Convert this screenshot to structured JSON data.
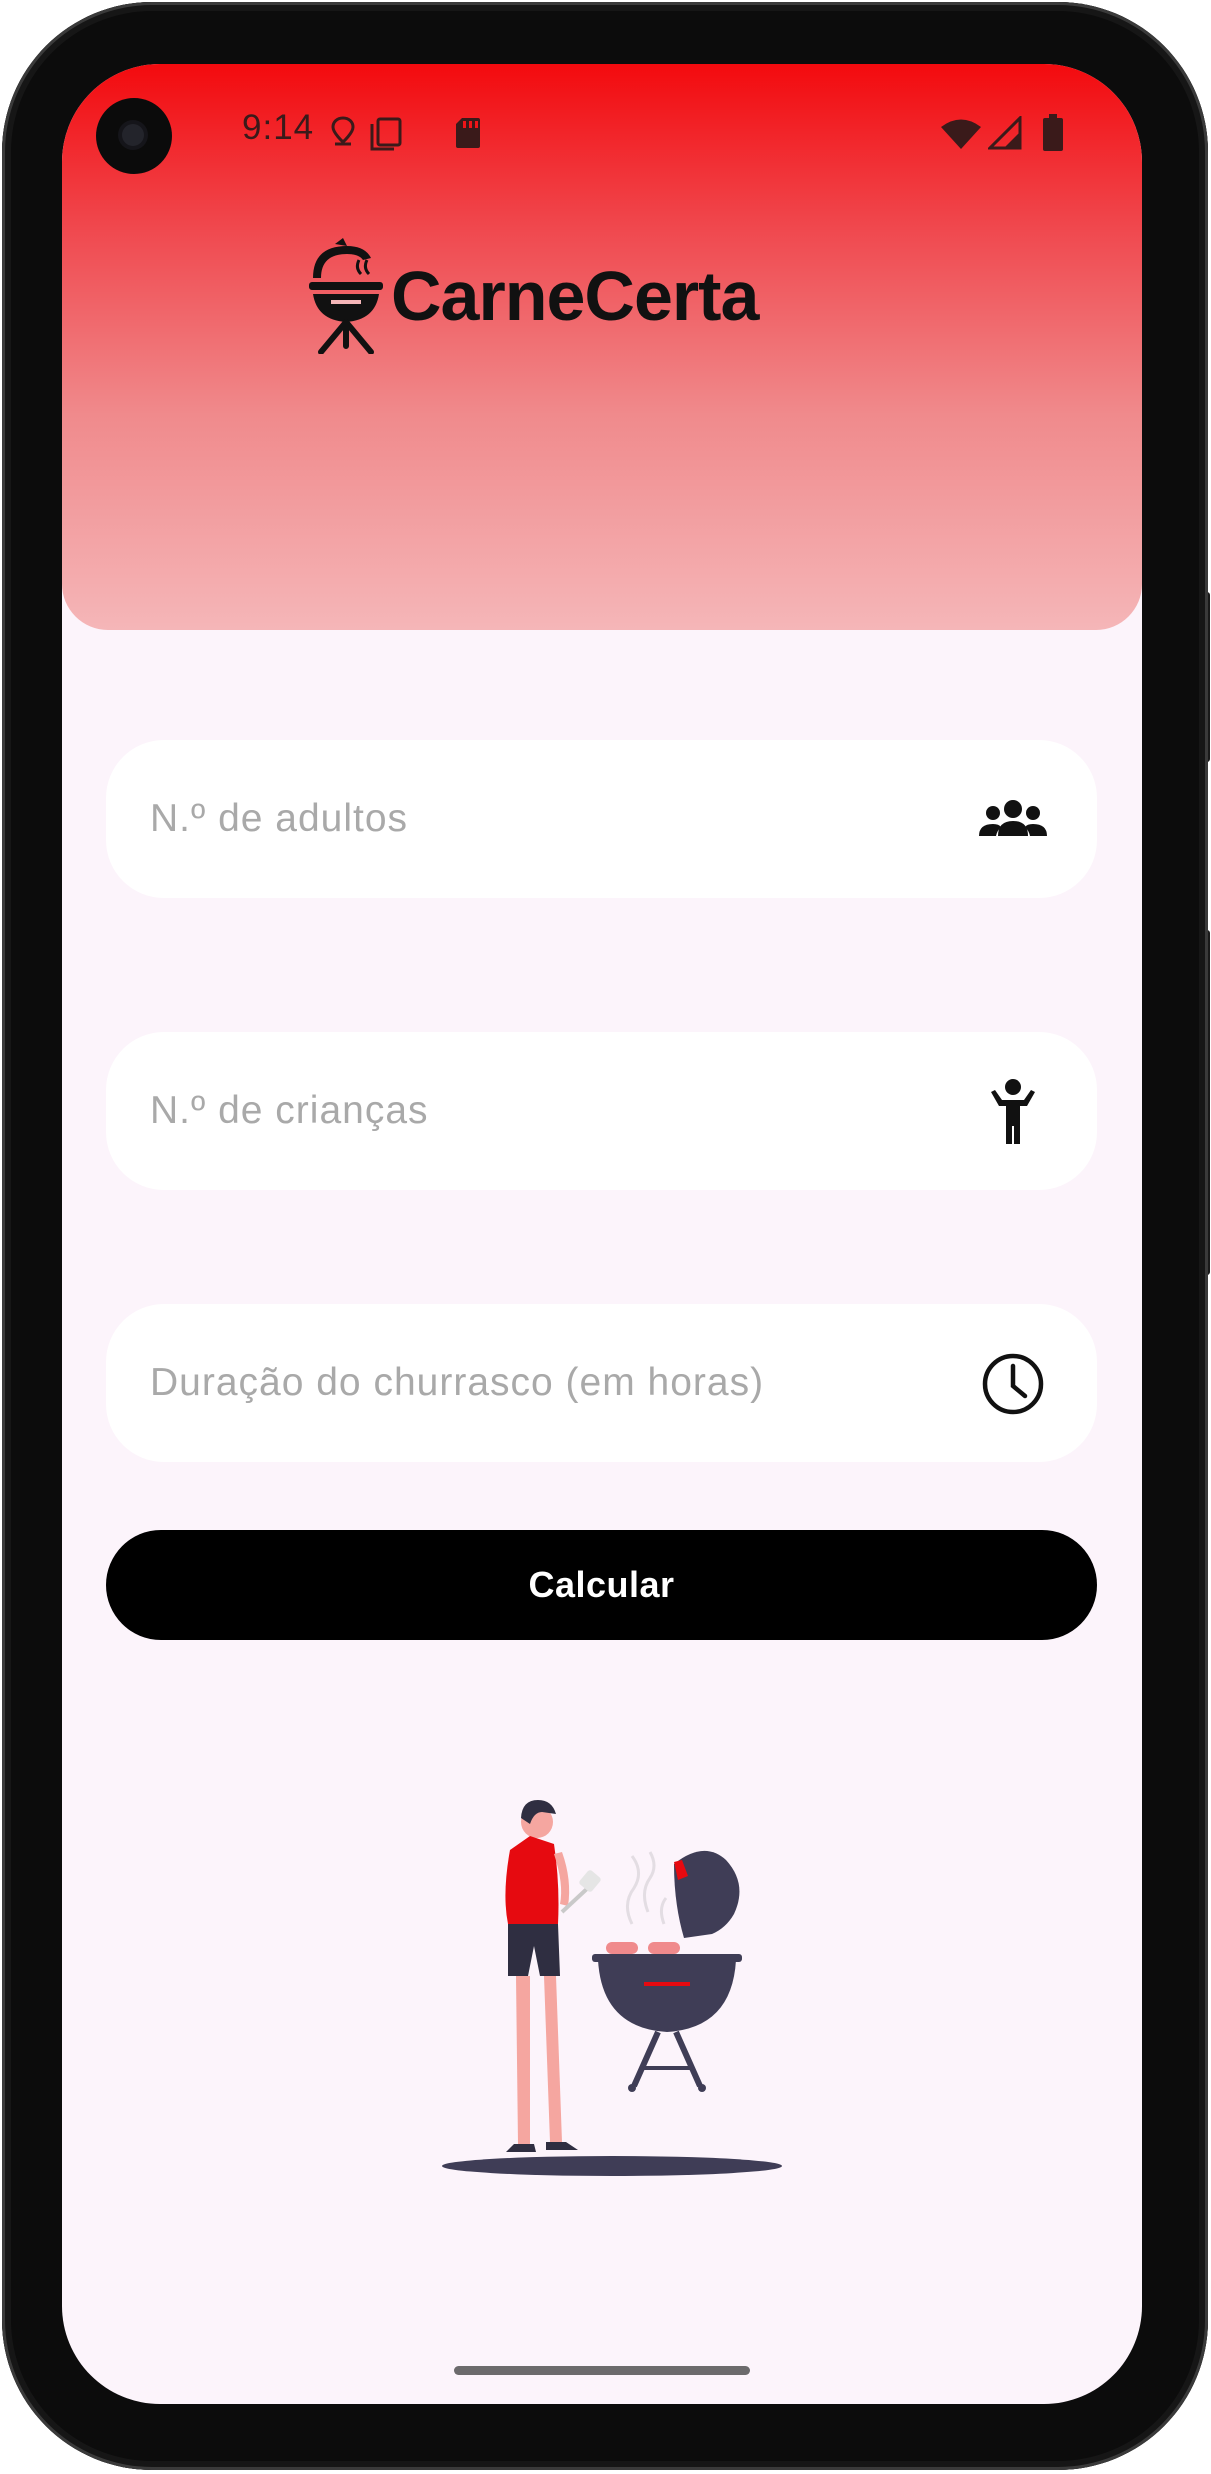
{
  "status_bar": {
    "time": "9:14",
    "left_icons": [
      "location-icon",
      "copy-icon",
      "sd-card-icon"
    ],
    "right_icons": [
      "wifi-icon",
      "signal-icon",
      "battery-icon"
    ]
  },
  "header": {
    "app_name": "CarneCerta",
    "logo_icon": "grill-icon",
    "colors": {
      "top": "#f30a0e",
      "bottom": "#f5b6b8"
    }
  },
  "form": {
    "adults": {
      "placeholder": "N.º de adultos",
      "value": "",
      "icon": "group-icon"
    },
    "children": {
      "placeholder": "N.º de crianças",
      "value": "",
      "icon": "child-icon"
    },
    "duration": {
      "placeholder": "Duração do churrasco (em horas)",
      "value": "",
      "icon": "clock-icon"
    },
    "submit_label": "Calcular"
  },
  "illustration": {
    "name": "person-grilling-illustration",
    "accent": "#e60a10"
  },
  "colors": {
    "background": "#fcf4fb",
    "field": "#ffffff",
    "button": "#000000",
    "button_text": "#ffffff"
  }
}
